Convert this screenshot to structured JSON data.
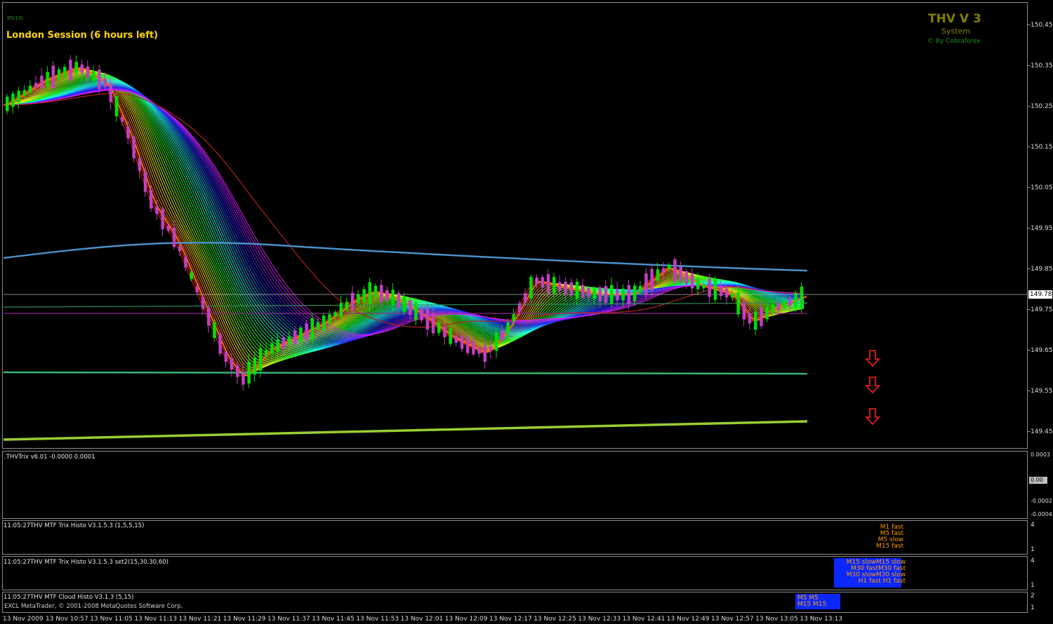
{
  "chart": {
    "session_label": "London Session (6 hours left)",
    "corner_code": "85(10)",
    "brand_title": "THV V 3",
    "brand_subtitle": "System",
    "brand_credit": "© By Cobraforex",
    "current_price": "149.78",
    "price_axis": [
      "150.45",
      "150.35",
      "150.25",
      "150.15",
      "150.05",
      "149.95",
      "149.85",
      "149.75",
      "149.65",
      "149.55",
      "149.45"
    ],
    "colors": {
      "bull": "#00e000",
      "bear": "#c040c0",
      "ma_blue": "#4a90c8",
      "support_green": "#3cb371",
      "support_lime": "#9acd32",
      "arrow_red": "#ff2020",
      "session_text": "#ffd700"
    }
  },
  "trix": {
    "title": ".THVTrix v6.01 -0.0000 0.0001",
    "axis": [
      "0.0003",
      "0.00",
      "-0.0002",
      "-0.0004"
    ]
  },
  "histo1": {
    "title": "11:05:27THV MTF Trix Histo V3.1.5.3 (1,5,5,15)",
    "legend": [
      "M1 fast",
      "M5 fast",
      "M5 slow",
      "M15 fast"
    ],
    "axis": [
      "4",
      "1"
    ]
  },
  "histo2": {
    "title": "11:05:27THV MTF Trix Histo V3.1.5.3  set2(15,30,30,60)",
    "legend": [
      "M15 slowM15 slow",
      "M30 fastM30 fast",
      "M30 slowM30 slow",
      "H1 fast  H1 fast"
    ],
    "axis": [
      "4",
      "1"
    ]
  },
  "histo3": {
    "title": "11:05:27THV MTF Cloud Histo V3.1.3 (5,15)",
    "footer": "EXCL  MetaTrader, © 2001-2008 MetaQuotes Software Corp.",
    "legend": [
      "M5    M5",
      "M15   M15"
    ],
    "axis": [
      "2",
      "1"
    ]
  },
  "time_axis": [
    "13 Nov 2009",
    "13 Nov 10:57",
    "13 Nov 11:05",
    "13 Nov 11:13",
    "13 Nov 11:21",
    "13 Nov 11:29",
    "13 Nov 11:37",
    "13 Nov 11:45",
    "13 Nov 11:53",
    "13 Nov 12:01",
    "13 Nov 12:09",
    "13 Nov 12:17",
    "13 Nov 12:25",
    "13 Nov 12:33",
    "13 Nov 12:41",
    "13 Nov 12:49",
    "13 Nov 12:57",
    "13 Nov 13:05",
    "13 Nov 13:13"
  ]
}
